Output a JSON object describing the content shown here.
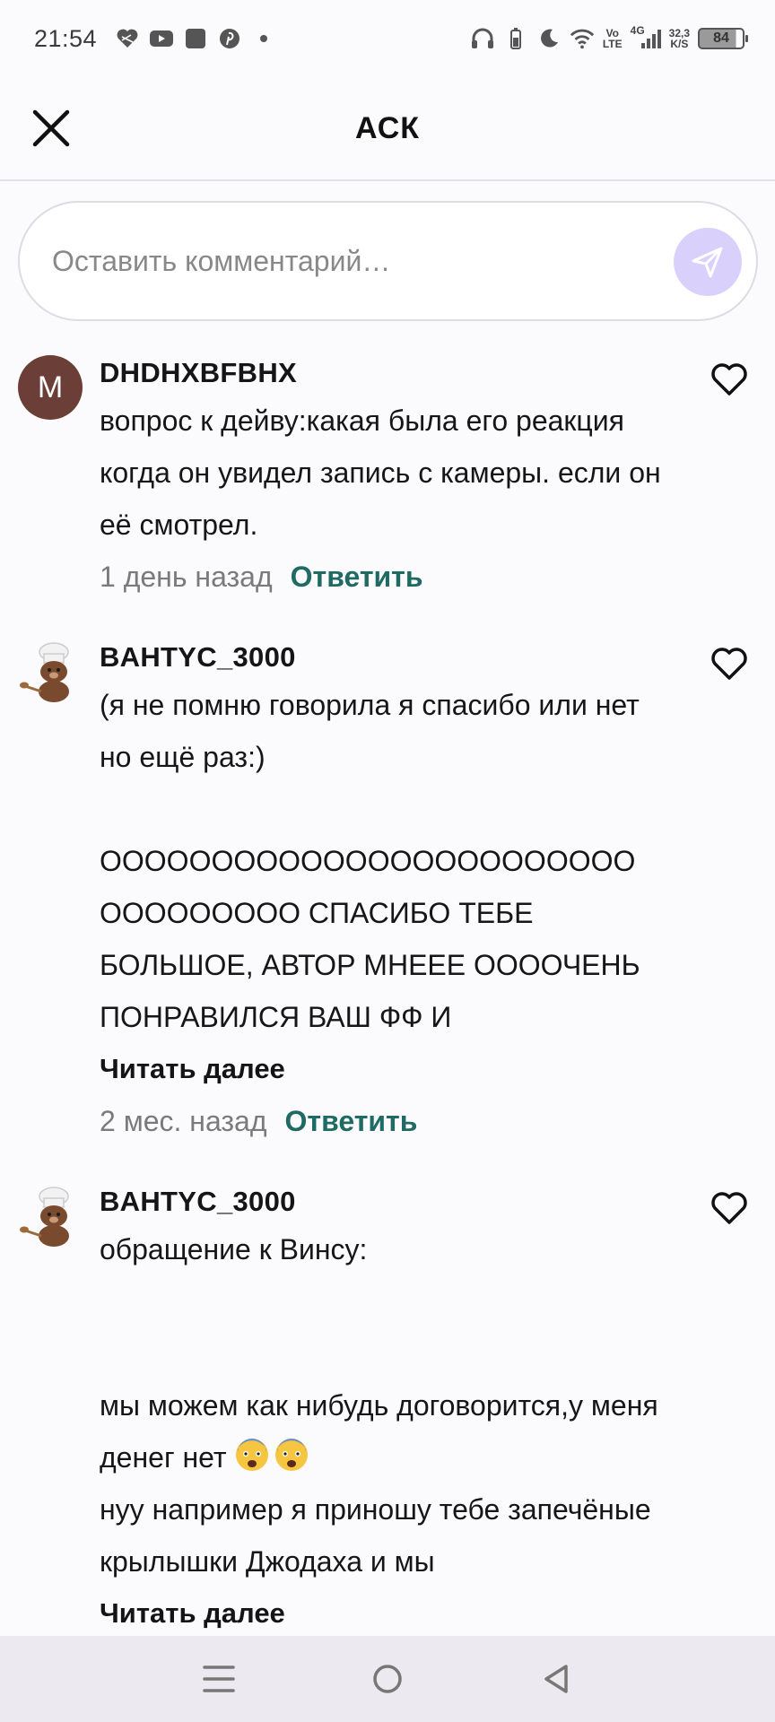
{
  "status_bar": {
    "time": "21:54",
    "net_top": "Vo",
    "net_bottom": "LTE",
    "signal_label": "4G",
    "speed_top": "32,3",
    "speed_bottom": "K/S",
    "battery": "84",
    "icons": [
      "heart-icon",
      "youtube-icon",
      "app-square-icon",
      "pinterest-icon",
      "dot-icon",
      "headphones-icon",
      "battery-small-icon",
      "moon-icon",
      "wifi-icon",
      "cell-signal-icon"
    ]
  },
  "header": {
    "title": "АСК",
    "close_icon": "close-icon"
  },
  "comment_input": {
    "placeholder": "Оставить комментарий…",
    "value": "",
    "send_icon": "send-icon"
  },
  "comments": [
    {
      "author": "DHDHXBFBHX",
      "avatar_letter": "M",
      "text": "вопрос к дейву:какая была его реакция когда он увидел запись с камеры. если он её смотрел.",
      "time": "1 день назад",
      "reply_label": "Ответить"
    },
    {
      "author": "BAHTYC_3000",
      "text": "(я не помню говорила я спасибо или нет но ещё раз:)\n\nОООООООООООООООООООООООО ООООООООО СПАСИБО ТЕБЕ БОЛЬШОЕ, АВТОР МНЕЕЕ ООООЧЕНЬ ПОНРАВИЛСЯ ВАШ ФФ И",
      "read_more": "Читать далее",
      "time": "2 мес. назад",
      "reply_label": "Ответить"
    },
    {
      "author": "BAHTYC_3000",
      "text_a": "обращение к Винсу:\n\n\nмы можем как нибудь договорится,у меня денег нет",
      "text_b": "нуу например я приношу  тебе запечёные крылышки Джодаха и мы",
      "read_more": "Читать далее"
    }
  ],
  "colors": {
    "accent_reply": "#1f6b63",
    "send_button_bg": "#d9d1fb",
    "avatar_m_bg": "#6b3f38"
  },
  "nav_bar": {
    "icons": [
      "menu-icon",
      "home-icon",
      "back-icon"
    ]
  }
}
